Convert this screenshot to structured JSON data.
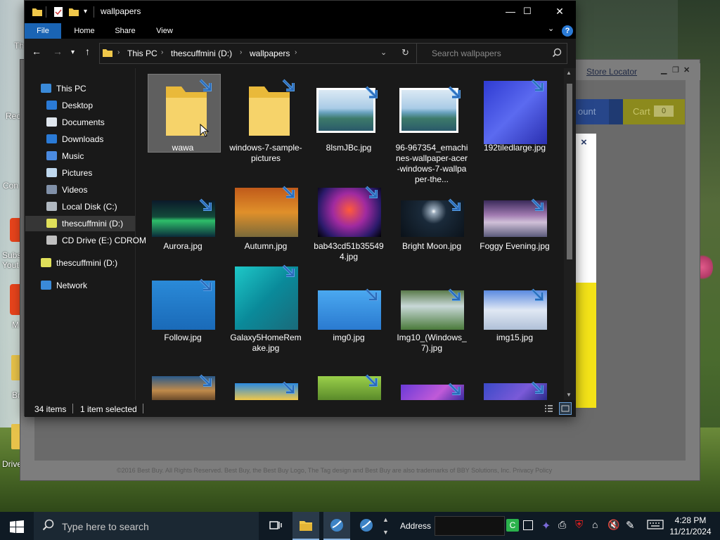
{
  "desktop": {
    "icons": [
      {
        "label": "Th",
        "icon": "desktop-icon"
      },
      {
        "label": "Rec",
        "icon": "recycle-bin-icon"
      },
      {
        "label": "Con",
        "icon": "control-panel-icon"
      },
      {
        "label": "Subs",
        "icon": "app-icon"
      },
      {
        "label": "Yout",
        "icon": "app-icon"
      },
      {
        "label": "M",
        "icon": "app-icon"
      },
      {
        "label": "Br",
        "icon": "app-icon"
      },
      {
        "label": "Drive",
        "icon": "drive-icon"
      }
    ]
  },
  "background_window": {
    "store_locator": "Store Locator",
    "account_label": "ount",
    "cart_label": "Cart",
    "cart_count": "0",
    "modal_close": "×",
    "footer": "©2016 Best Buy. All Rights Reserved. Best Buy, the Best Buy Logo, The Tag design and Best Buy are also trademarks of BBY Solutions, Inc.   Privacy Policy"
  },
  "explorer": {
    "title": "wallpapers",
    "ribbon": {
      "file": "File",
      "home": "Home",
      "share": "Share",
      "view": "View"
    },
    "breadcrumbs": [
      "This PC",
      "thescuffmini (D:)",
      "wallpapers"
    ],
    "search_placeholder": "Search wallpapers",
    "nav": [
      {
        "label": "This PC",
        "icon": "this-pc-icon",
        "level": 0
      },
      {
        "label": "Desktop",
        "icon": "desktop-folder-icon",
        "level": 1
      },
      {
        "label": "Documents",
        "icon": "documents-icon",
        "level": 1
      },
      {
        "label": "Downloads",
        "icon": "downloads-icon",
        "level": 1
      },
      {
        "label": "Music",
        "icon": "music-icon",
        "level": 1
      },
      {
        "label": "Pictures",
        "icon": "pictures-icon",
        "level": 1
      },
      {
        "label": "Videos",
        "icon": "videos-icon",
        "level": 1
      },
      {
        "label": "Local Disk (C:)",
        "icon": "local-disk-icon",
        "level": 1
      },
      {
        "label": "thescuffmini (D:)",
        "icon": "usb-drive-icon",
        "level": 1
      },
      {
        "label": "CD Drive (E:) CDROM",
        "icon": "cd-drive-icon",
        "level": 1
      },
      {
        "label": "thescuffmini (D:)",
        "icon": "usb-drive-icon",
        "level": 0
      },
      {
        "label": "Network",
        "icon": "network-icon",
        "level": 0
      }
    ],
    "items": [
      {
        "label": "wawa",
        "kind": "folder",
        "selected": true
      },
      {
        "label": "windows-7-sample-pictures",
        "kind": "folder"
      },
      {
        "label": "8lsmJBc.jpg",
        "kind": "landscape"
      },
      {
        "label": "96-967354_emachines-wallpaper-acer-windows-7-wallpaper-the...",
        "kind": "landscape"
      },
      {
        "label": "192tiledlarge.jpg",
        "kind": "pixel-cat"
      },
      {
        "label": "Aurora.jpg",
        "kind": "aurora"
      },
      {
        "label": "Autumn.jpg",
        "kind": "autumn"
      },
      {
        "label": "bab43cd51b355494.jpg",
        "kind": "wolf"
      },
      {
        "label": "Bright Moon.jpg",
        "kind": "moon"
      },
      {
        "label": "Foggy Evening.jpg",
        "kind": "foggy"
      },
      {
        "label": "Follow.jpg",
        "kind": "fish"
      },
      {
        "label": "Galaxy5HomeRemake.jpg",
        "kind": "galaxy"
      },
      {
        "label": "img0.jpg",
        "kind": "daisy"
      },
      {
        "label": "Img10_(Windows_7).jpg",
        "kind": "waterfall"
      },
      {
        "label": "img15.jpg",
        "kind": "building"
      },
      {
        "label": "",
        "kind": "rock"
      },
      {
        "label": "",
        "kind": "beach"
      },
      {
        "label": "",
        "kind": "cat"
      },
      {
        "label": "",
        "kind": "space-purple"
      },
      {
        "label": "",
        "kind": "space-blue"
      }
    ],
    "status": {
      "count": "34 items",
      "selection": "1 item selected"
    }
  },
  "taskbar": {
    "search_placeholder": "Type here to search",
    "address_label": "Address",
    "time": "4:28 PM",
    "date": "11/21/2024"
  }
}
